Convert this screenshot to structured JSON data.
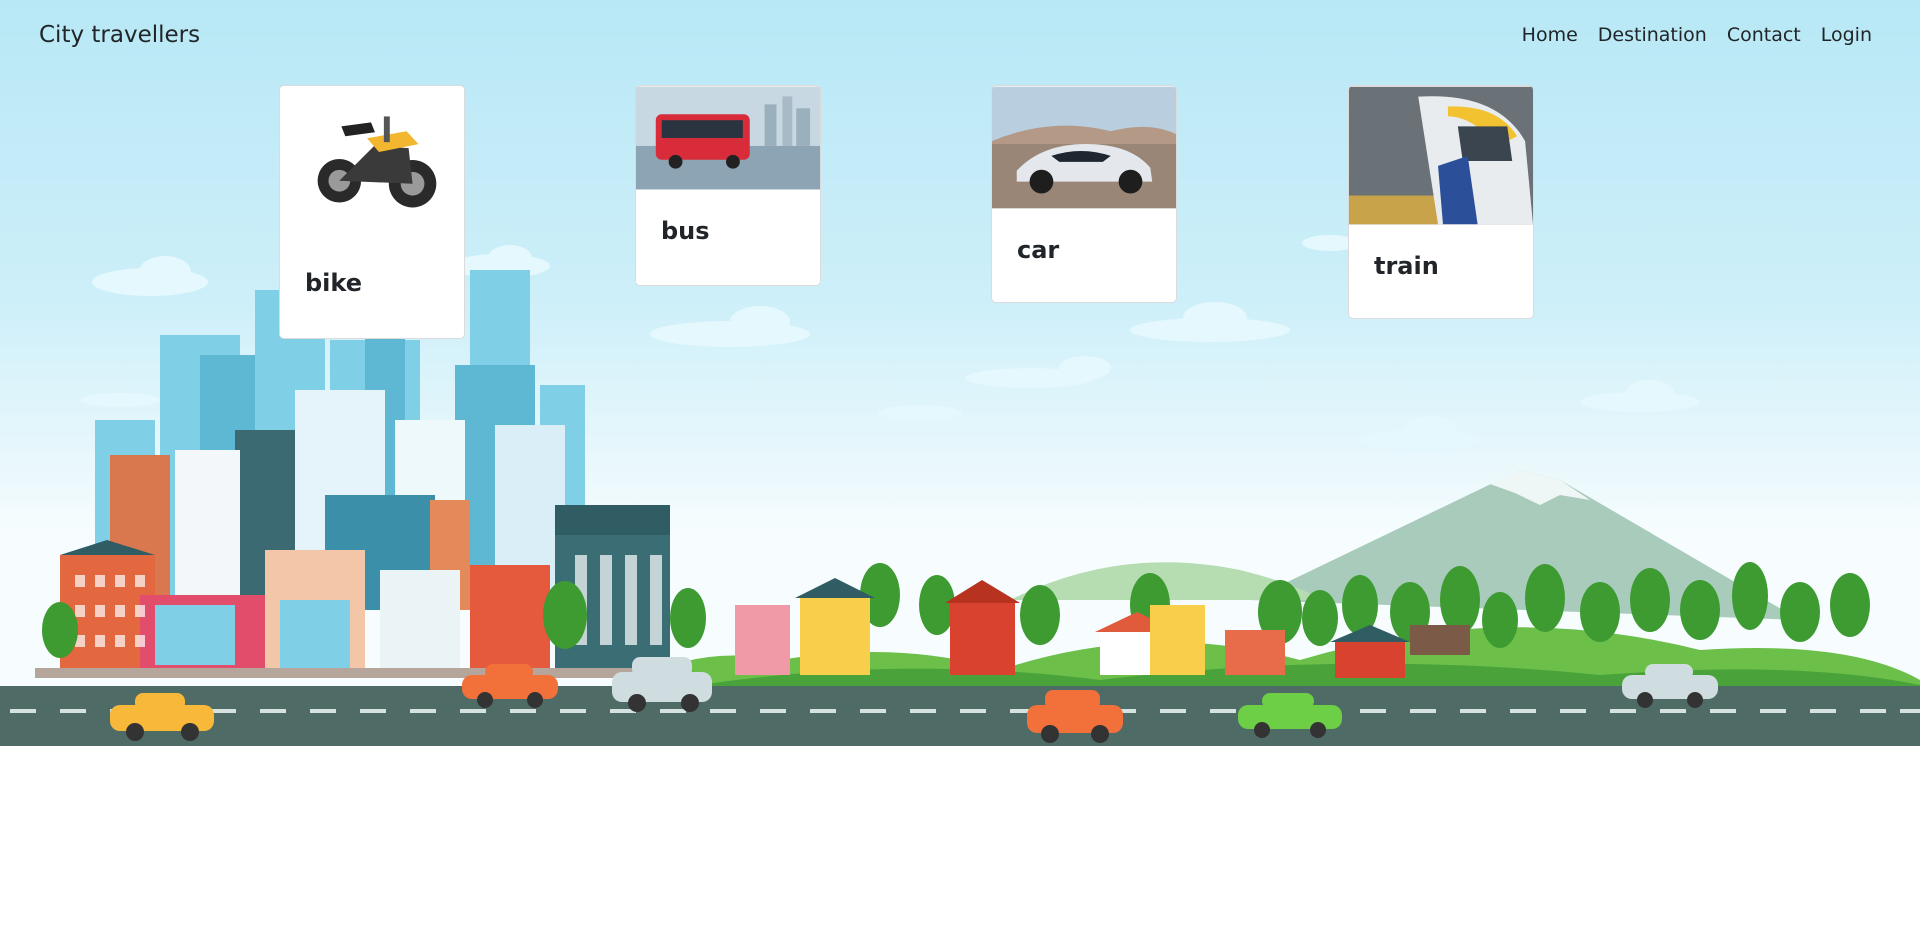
{
  "navbar": {
    "brand": "City travellers",
    "links": [
      "Home",
      "Destination",
      "Contact",
      "Login"
    ]
  },
  "cards": [
    {
      "title": "bike",
      "image": "motorcycle-photo"
    },
    {
      "title": "bus",
      "image": "bus-photo"
    },
    {
      "title": "car",
      "image": "sports-car-photo"
    },
    {
      "title": "train",
      "image": "train-photo"
    }
  ],
  "colors": {
    "sky": "#b8e8f6",
    "road": "#4f6b66",
    "text": "#212529",
    "card_bg": "#ffffff"
  }
}
